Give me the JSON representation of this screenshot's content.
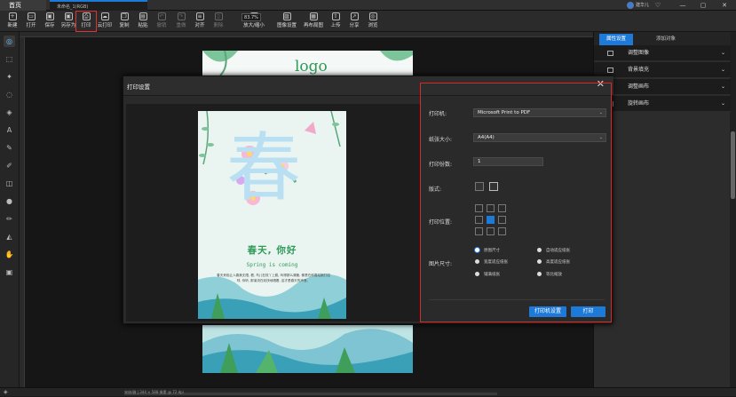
{
  "titlebar": {
    "home_tab": "首页",
    "doc_tab": "未命名_1(RGB)",
    "username": "建华儿",
    "controls": [
      "♡",
      "—",
      "▢",
      "✕"
    ]
  },
  "toolbar": {
    "items": [
      {
        "label": "新建",
        "icon": "new-icon",
        "glyph": "+"
      },
      {
        "label": "打开",
        "icon": "open-folder-icon",
        "glyph": "▭"
      },
      {
        "label": "保存",
        "icon": "save-icon",
        "glyph": "▣"
      },
      {
        "label": "另存为",
        "icon": "save-as-icon",
        "glyph": "▣"
      },
      {
        "label": "打印",
        "icon": "printer-icon",
        "glyph": "⎙"
      },
      {
        "label": "云打印",
        "icon": "cloud-print-icon",
        "glyph": "☁"
      },
      {
        "label": "复制",
        "icon": "copy-icon",
        "glyph": "❐"
      },
      {
        "label": "粘贴",
        "icon": "paste-icon",
        "glyph": "▤"
      },
      {
        "label": "撤销",
        "icon": "undo-icon",
        "glyph": "↶"
      },
      {
        "label": "重做",
        "icon": "redo-icon",
        "glyph": "↷"
      },
      {
        "label": "对齐",
        "icon": "align-icon",
        "glyph": "≡"
      },
      {
        "label": "删除",
        "icon": "delete-icon",
        "glyph": "▯"
      },
      {
        "label": "放大/缩小",
        "icon": "zoom-icon",
        "glyph": "⊕"
      },
      {
        "label": "图像设置",
        "icon": "image-settings-icon",
        "glyph": "▨"
      },
      {
        "label": "再布局图",
        "icon": "relayout-icon",
        "glyph": "▦"
      },
      {
        "label": "上传",
        "icon": "upload-icon",
        "glyph": "⇧"
      },
      {
        "label": "分享",
        "icon": "share-icon",
        "glyph": "↗"
      },
      {
        "label": "浏览",
        "icon": "browse-icon",
        "glyph": "◎"
      }
    ],
    "zoom_value": "83.7%"
  },
  "left_tools": [
    "zoom-tool-icon",
    "marquee-tool-icon",
    "magic-wand-icon",
    "lasso-icon",
    "fill-icon",
    "text-tool-icon",
    "pen-tool-icon",
    "brush-icon",
    "eraser-icon",
    "blur-icon",
    "pencil-icon",
    "shape-icon",
    "hand-icon",
    "crop-icon"
  ],
  "right_panel": {
    "tabs": [
      "属性设置",
      "添加对象"
    ],
    "rows": [
      {
        "label": "调整图像",
        "icon": "adjust-image-icon"
      },
      {
        "label": "背景填充",
        "icon": "background-fill-icon"
      },
      {
        "label": "调整画布",
        "icon": "adjust-canvas-icon"
      },
      {
        "label": "旋转画布",
        "icon": "rotate-canvas-icon"
      }
    ]
  },
  "canvas_art": {
    "logo_text": "logo"
  },
  "dialog": {
    "title": "打印设置",
    "close": "✕",
    "printer_label": "打印机:",
    "printer_value": "Microsoft Print to PDF",
    "paper_label": "纸张大小:",
    "paper_value": "A4(A4)",
    "copies_label": "打印份数:",
    "copies_value": "1",
    "layout_label": "版式:",
    "position_label": "打印位置:",
    "image_size_label": "图片尺寸:",
    "size_options": [
      {
        "label": "原图尺寸",
        "selected": true
      },
      {
        "label": "自动适应纸张",
        "selected": false
      },
      {
        "label": "宽度适应纸张",
        "selected": false
      },
      {
        "label": "高度适应纸张",
        "selected": false
      },
      {
        "label": "铺满纸张",
        "selected": false
      },
      {
        "label": "等比缩放",
        "selected": false
      }
    ],
    "printer_settings_button": "打印机设置",
    "print_button": "打印"
  },
  "poster": {
    "headline": "春天, 你好",
    "sub": "Spring is coming",
    "body": "春天来临让人喜美无限, 看, 鸟儿在枝丫上跳, 叫得那么清脆, 像是在和春姑娘打招呼, 你听, 那溪流在欢快地唱着, 这才是春天的声音。",
    "glyph": "春"
  },
  "statusbar": {
    "info": "宋体/微 | 344 × 588 像素 @ 72 dpi"
  },
  "colors": {
    "accent": "#1e7ad8",
    "highlight_red": "#e02525",
    "poster_green": "#2e9a58"
  }
}
